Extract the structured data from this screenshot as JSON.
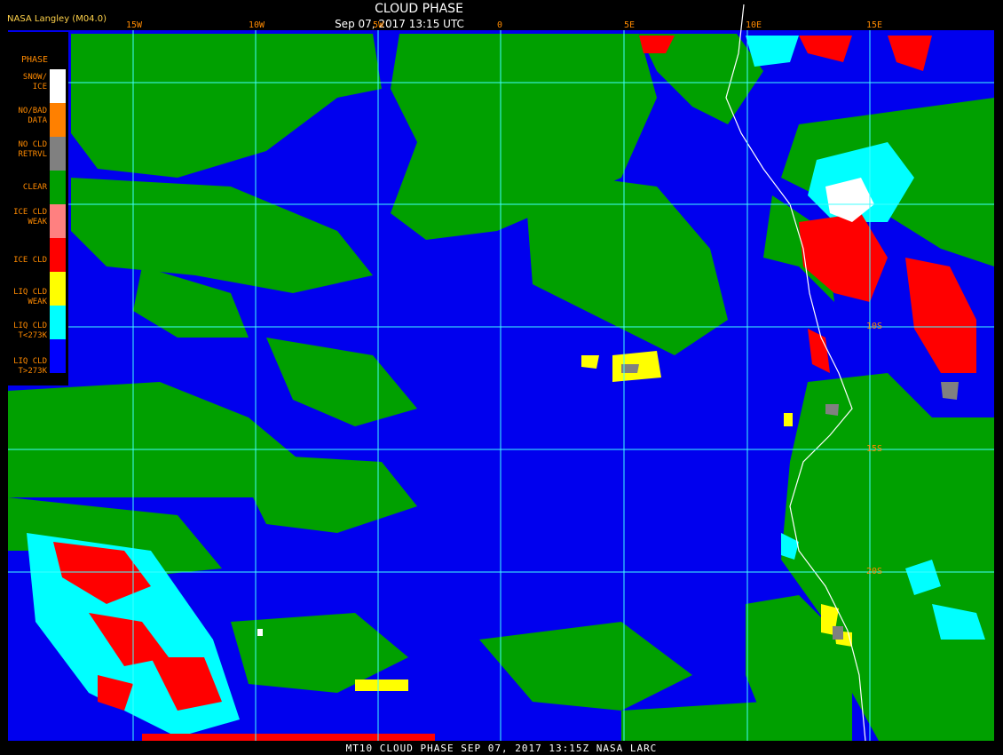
{
  "header": {
    "org": "NASA Langley (M04.0)",
    "title": "CLOUD PHASE",
    "subtitle": "Sep 07, 2017 13:15 UTC"
  },
  "footer": "MT10  CLOUD PHASE    SEP 07, 2017 13:15Z    NASA LARC",
  "grid": {
    "lon_labels": [
      "15W",
      "10W",
      "5W",
      "0",
      "5E",
      "10E",
      "15E"
    ],
    "lat_labels": [
      "10S",
      "15S",
      "20S"
    ]
  },
  "legend": {
    "title": "PHASE",
    "items": [
      {
        "label": "SNOW/\nICE",
        "color": "#ffffff"
      },
      {
        "label": "NO/BAD\nDATA",
        "color": "#ff8000"
      },
      {
        "label": "NO CLD\nRETRVL",
        "color": "#808080"
      },
      {
        "label": "CLEAR",
        "color": "#00a000"
      },
      {
        "label": "ICE CLD\nWEAK",
        "color": "#ff8080"
      },
      {
        "label": "ICE CLD",
        "color": "#ff0000"
      },
      {
        "label": "LIQ CLD\nWEAK",
        "color": "#ffff00"
      },
      {
        "label": "LIQ CLD\nT<273K",
        "color": "#00ffff"
      },
      {
        "label": "LIQ CLD\nT>273K",
        "color": "#0000ff"
      }
    ]
  },
  "colors": {
    "ocean_liquid": "#0000ee",
    "clear": "#00a000",
    "ice": "#ff0000",
    "ice_weak": "#ff8080",
    "liq_cold": "#00ffff",
    "liq_weak": "#ffff00",
    "no_retrieval": "#808080",
    "snow": "#ffffff",
    "grid": "#40ffff",
    "coast": "#ffffff"
  }
}
